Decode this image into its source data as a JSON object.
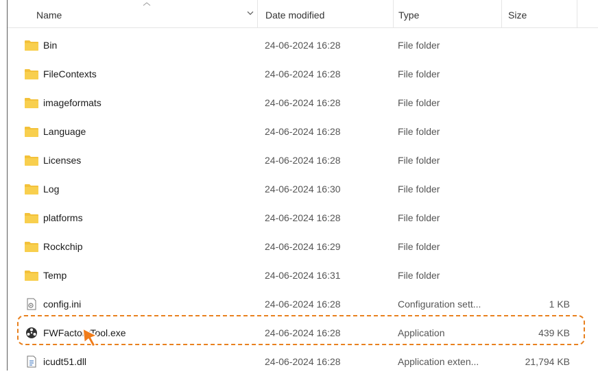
{
  "columns": {
    "name": "Name",
    "date": "Date modified",
    "type": "Type",
    "size": "Size"
  },
  "colors": {
    "folder": "#f3c13a",
    "highlight": "#e8801e",
    "cursor": "#f07c1a"
  },
  "rows": [
    {
      "name": "Bin",
      "date": "24-06-2024 16:28",
      "type": "File folder",
      "size": "",
      "icon": "folder-icon"
    },
    {
      "name": "FileContexts",
      "date": "24-06-2024 16:28",
      "type": "File folder",
      "size": "",
      "icon": "folder-icon"
    },
    {
      "name": "imageformats",
      "date": "24-06-2024 16:28",
      "type": "File folder",
      "size": "",
      "icon": "folder-icon"
    },
    {
      "name": "Language",
      "date": "24-06-2024 16:28",
      "type": "File folder",
      "size": "",
      "icon": "folder-icon"
    },
    {
      "name": "Licenses",
      "date": "24-06-2024 16:28",
      "type": "File folder",
      "size": "",
      "icon": "folder-icon"
    },
    {
      "name": "Log",
      "date": "24-06-2024 16:30",
      "type": "File folder",
      "size": "",
      "icon": "folder-icon"
    },
    {
      "name": "platforms",
      "date": "24-06-2024 16:28",
      "type": "File folder",
      "size": "",
      "icon": "folder-icon"
    },
    {
      "name": "Rockchip",
      "date": "24-06-2024 16:29",
      "type": "File folder",
      "size": "",
      "icon": "folder-icon"
    },
    {
      "name": "Temp",
      "date": "24-06-2024 16:31",
      "type": "File folder",
      "size": "",
      "icon": "folder-icon"
    },
    {
      "name": "config.ini",
      "date": "24-06-2024 16:28",
      "type": "Configuration sett...",
      "size": "1 KB",
      "icon": "settings-file-icon"
    },
    {
      "name": "FWFactoryTool.exe",
      "date": "24-06-2024 16:28",
      "type": "Application",
      "size": "439 KB",
      "icon": "application-icon"
    },
    {
      "name": "icudt51.dll",
      "date": "24-06-2024 16:28",
      "type": "Application exten...",
      "size": "21,794 KB",
      "icon": "dll-file-icon"
    }
  ]
}
